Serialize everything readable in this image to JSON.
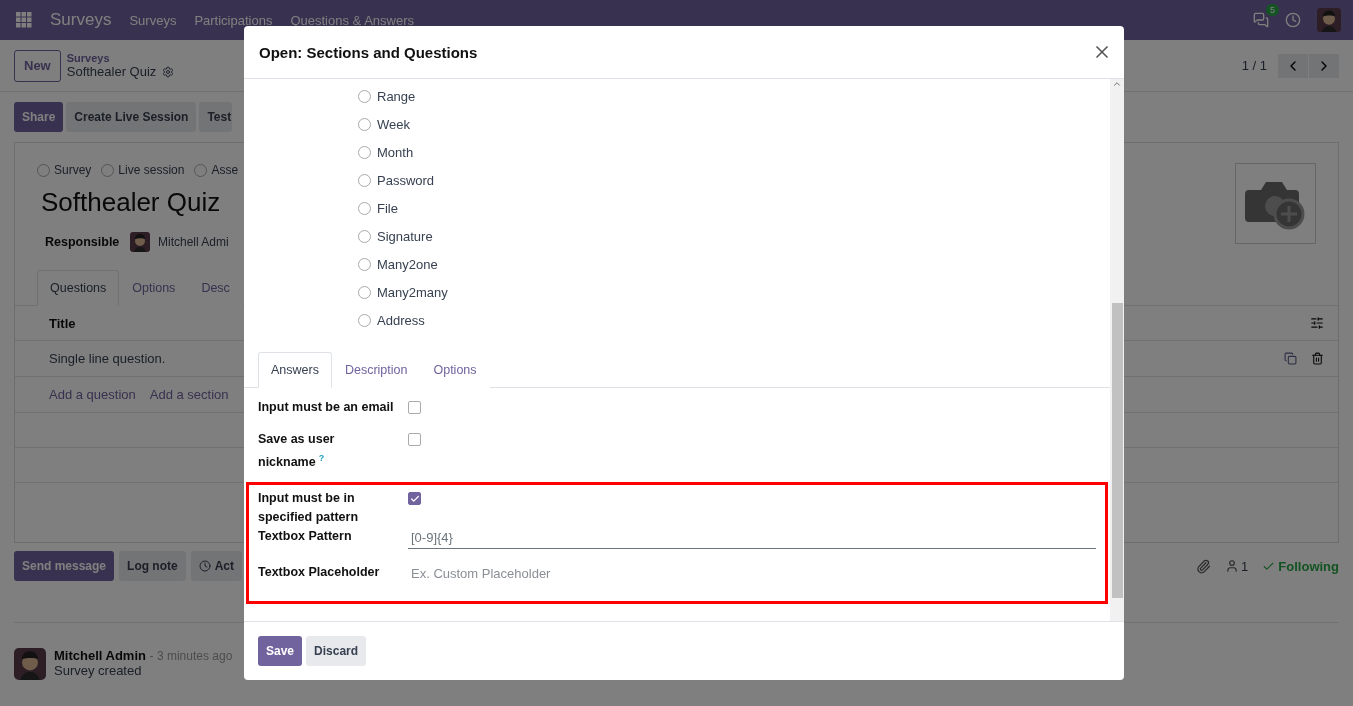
{
  "navbar": {
    "app_name": "Surveys",
    "menu": [
      "Surveys",
      "Participations",
      "Questions & Answers"
    ],
    "messages_badge": "5"
  },
  "control_panel": {
    "new_button": "New",
    "breadcrumb": "Surveys",
    "record": "Softhealer Quiz",
    "pager": "1 / 1"
  },
  "actions": [
    {
      "label": "Share",
      "primary": true
    },
    {
      "label": "Create Live Session",
      "primary": false
    },
    {
      "label": "Test",
      "primary": false
    }
  ],
  "form": {
    "survey_types": [
      {
        "label": "Survey",
        "selected": false
      },
      {
        "label": "Live session",
        "selected": false
      },
      {
        "label": "Asse",
        "selected": false
      }
    ],
    "title": "Softhealer Quiz",
    "responsible_label": "Responsible",
    "responsible": "Mitchell Admi",
    "tabs": [
      {
        "label": "Questions",
        "selected": true
      },
      {
        "label": "Options",
        "selected": false
      },
      {
        "label": "Desc",
        "selected": false
      }
    ],
    "table": {
      "columns": [
        "Title"
      ],
      "rows": [
        "Single line question."
      ],
      "add_links": [
        "Add a question",
        "Add a section"
      ]
    }
  },
  "chatter": {
    "buttons": [
      {
        "label": "Send message",
        "primary": true
      },
      {
        "label": "Log note",
        "primary": false
      },
      {
        "label": "Act",
        "primary": false
      }
    ],
    "followers": "1",
    "following": "Following",
    "messages": [
      {
        "author": "Mitchell Admin",
        "time": "- 3 minutes ago",
        "body": "Survey created"
      }
    ]
  },
  "modal": {
    "title": "Open: Sections and Questions",
    "question_types": [
      {
        "label": "Range",
        "selected": false
      },
      {
        "label": "Week",
        "selected": false
      },
      {
        "label": "Month",
        "selected": false
      },
      {
        "label": "Password",
        "selected": false
      },
      {
        "label": "File",
        "selected": false
      },
      {
        "label": "Signature",
        "selected": false
      },
      {
        "label": "Many2one",
        "selected": false
      },
      {
        "label": "Many2many",
        "selected": false
      },
      {
        "label": "Address",
        "selected": false
      }
    ],
    "tabs": [
      {
        "label": "Answers",
        "selected": true
      },
      {
        "label": "Description",
        "selected": false
      },
      {
        "label": "Options",
        "selected": false
      }
    ],
    "rows": [
      {
        "kind": "checkbox",
        "label": "Input must be an email",
        "checked": false,
        "highlighted": false
      },
      {
        "kind": "checkbox",
        "label": "Save as user nickname",
        "help": "?",
        "checked": false,
        "highlighted": false
      },
      {
        "kind": "checkbox",
        "label": "Input must be in specified pattern",
        "checked": true,
        "highlighted": true
      },
      {
        "kind": "field",
        "label": "Textbox Pattern",
        "value": "[0-9]{4}",
        "highlighted": true
      },
      {
        "kind": "field",
        "label": "Textbox Placeholder",
        "placeholder": "Ex. Custom Placeholder",
        "highlighted": true
      }
    ],
    "buttons": [
      {
        "label": "Save",
        "primary": true
      },
      {
        "label": "Discard",
        "primary": false
      }
    ]
  }
}
